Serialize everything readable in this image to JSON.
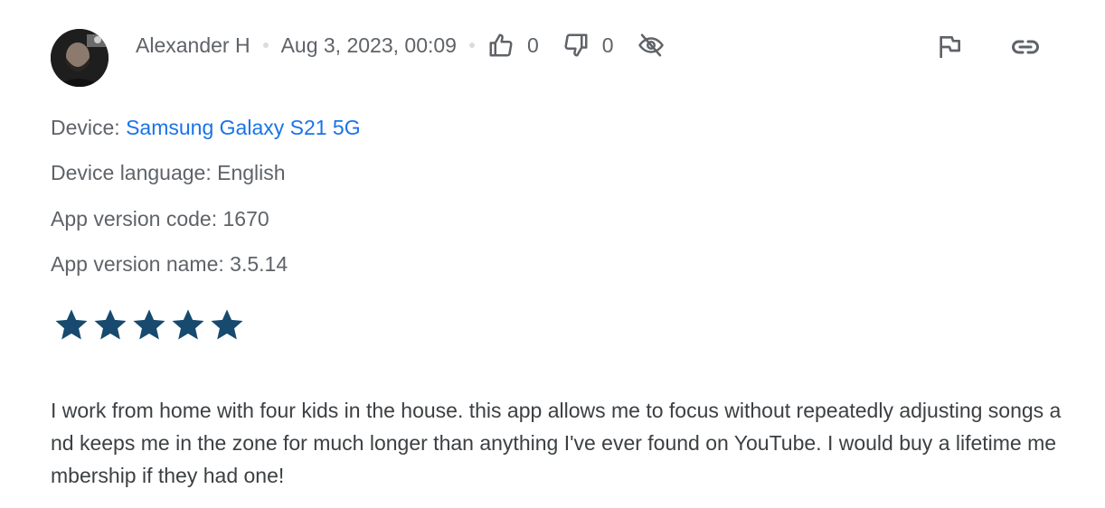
{
  "review": {
    "author": "Alexander H",
    "date": "Aug 3, 2023, 00:09",
    "thumbs_up_count": "0",
    "thumbs_down_count": "0",
    "device_label": "Device: ",
    "device_name": "Samsung Galaxy S21 5G",
    "device_language": "Device language: English",
    "app_version_code": "App version code: 1670",
    "app_version_name": "App version name: 3.5.14",
    "rating": 5,
    "rating_max": 5,
    "text": "I work from home with four kids in the house. this app allows me to focus without repeatedly adjusting songs and keeps me in the zone for much longer than anything I've ever found on YouTube. I would buy a lifetime membership if they had one!"
  },
  "icons": {
    "thumbs_up": "thumbs-up-icon",
    "thumbs_down": "thumbs-down-icon",
    "hide": "eye-off-icon",
    "flag": "flag-icon",
    "link": "link-icon"
  },
  "colors": {
    "star": "#174a6e",
    "link": "#1a73e8",
    "text": "#3c4043",
    "secondary": "#5f6368"
  }
}
